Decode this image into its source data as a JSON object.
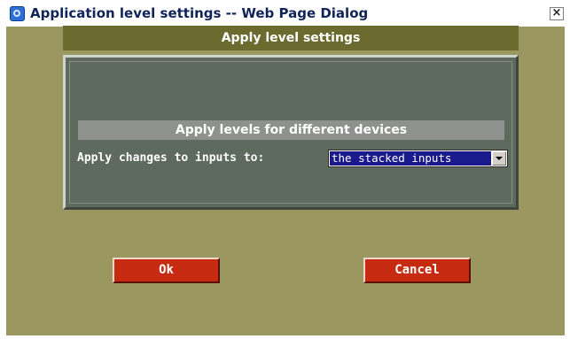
{
  "window": {
    "title": "Application level settings -- Web Page Dialog",
    "close_symbol": "×",
    "icon": "ie-document-icon"
  },
  "dialog": {
    "header": "Apply level settings",
    "panel": {
      "subheader": "Apply levels for different devices",
      "field_label": "Apply changes to inputs to:",
      "select_value": "the stacked inputs"
    }
  },
  "buttons": {
    "ok_label": "Ok",
    "cancel_label": "Cancel"
  },
  "colors": {
    "dialog_background": "#9a9760",
    "header_background": "#6b6b2f",
    "panel_background": "#5e6a5e",
    "subheader_background": "#8e918e",
    "button_red": "#c62b12",
    "selection_blue": "#1a1a8c"
  }
}
